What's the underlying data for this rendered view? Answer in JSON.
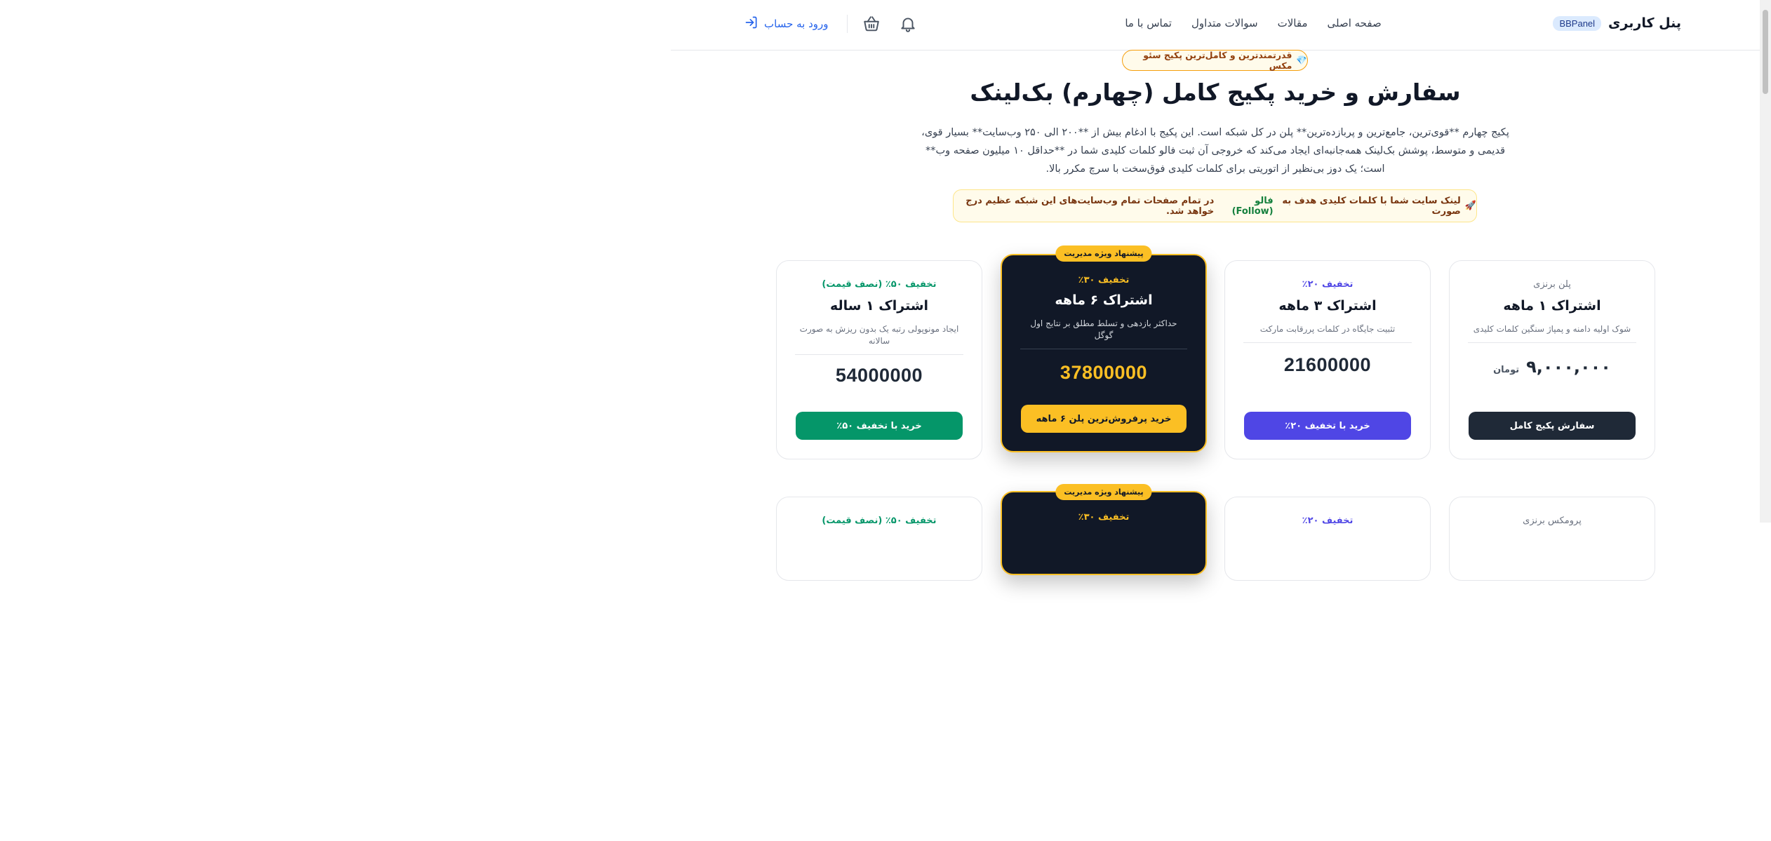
{
  "header": {
    "brand_title": "پنل کاربری",
    "brand_badge": "BBPanel",
    "nav": [
      "صفحه اصلی",
      "مقالات",
      "سوالات متداول",
      "تماس با ما"
    ],
    "login_label": "ورود به حساب"
  },
  "hero": {
    "badge": "قدرتمندترین و کامل‌ترین پکیج سئو مکس",
    "badge_icon": "💎",
    "title": "سفارش و خرید پکیج کامل (چهارم) بک‌لینک",
    "description": "پکیج چهارم **قوی‌ترین، جامع‌ترین و پربازده‌ترین** پلن در کل شبکه است. این پکیج با ادغام بیش از **۲۰۰ الی ۲۵۰ وب‌سایت** بسیار قوی، قدیمی و متوسط، پوشش بک‌لینک همه‌جانبه‌ای ایجاد می‌کند که خروجی آن ثبت فالو کلمات کلیدی شما در **حداقل ۱۰ میلیون صفحه وب** است؛ یک دوز بی‌نظیر از اتوریتی برای کلمات کلیدی فوق‌سخت با سرچ مکرر بالا.",
    "notice_icon": "🚀",
    "notice_before": "لینک سایت شما با کلمات کلیدی هدف به صورت",
    "notice_follow": "فالو (Follow)",
    "notice_after": "در تمام صفحات تمام وب‌سایت‌های این شبکه عظیم درج خواهد شد."
  },
  "plans": [
    {
      "label": "پلن برنزی",
      "name": "اشتراک ۱ ماهه",
      "subtitle": "شوک اولیه دامنه و پمپاژ سنگین کلمات کلیدی",
      "price": "۹,۰۰۰,۰۰۰",
      "unit": "تومان",
      "button": "سفارش پکیج کامل"
    },
    {
      "label": "تخفیف ۲۰٪",
      "name": "اشتراک ۳ ماهه",
      "subtitle": "تثبیت جایگاه در کلمات پررقابت مارکت",
      "price": "21600000",
      "button": "خرید با تخفیف ۲۰٪"
    },
    {
      "ribbon": "پیشنهاد ویژه مدیریت",
      "label": "تخفیف ۳۰٪",
      "name": "اشتراک ۶ ماهه",
      "subtitle": "حداکثر بازدهی و تسلط مطلق بر نتایج اول گوگل",
      "price": "37800000",
      "button": "خرید پرفروش‌ترین پلن ۶ ماهه"
    },
    {
      "label": "تخفیف ۵۰٪ (نصف قیمت)",
      "name": "اشتراک ۱ ساله",
      "subtitle": "ایجاد مونوپولی رتبه یک بدون ریزش به صورت سالانه",
      "price": "54000000",
      "button": "خرید با تخفیف ۵۰٪"
    }
  ],
  "plans_row2": [
    {
      "label": "پرومکس برنزی"
    },
    {
      "label": "تخفیف ۲۰٪"
    },
    {
      "ribbon": "پیشنهاد ویژه مدیریت",
      "label": "تخفیف ۳۰٪"
    },
    {
      "label": "تخفیف ۵۰٪ (نصف قیمت)"
    }
  ]
}
